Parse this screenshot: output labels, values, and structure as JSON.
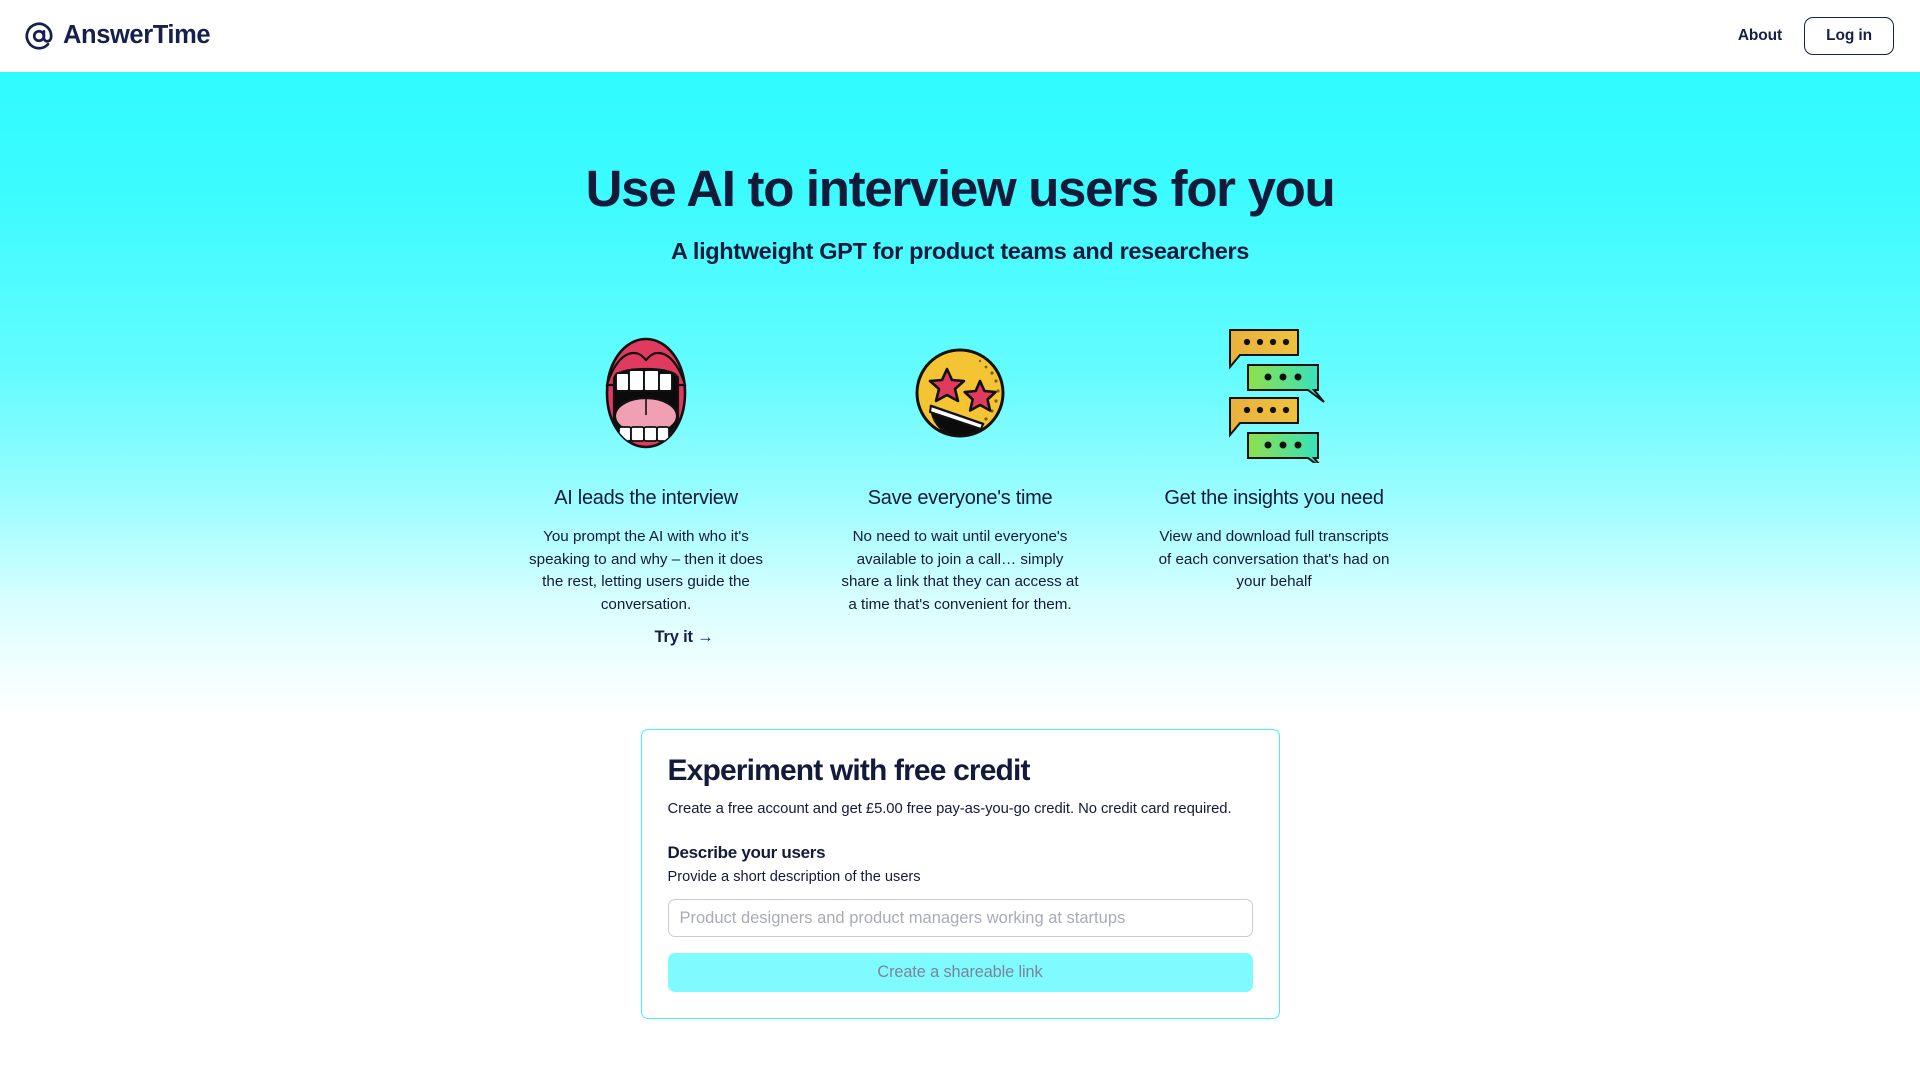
{
  "header": {
    "brand_name": "AnswerTime",
    "brand_icon": "at-circle-logo-icon",
    "about_label": "About",
    "login_label": "Log in"
  },
  "hero": {
    "headline": "Use AI to interview users for you",
    "subhead": "A lightweight GPT for product teams and researchers",
    "try_it_label": "Try it →"
  },
  "features": [
    {
      "icon": "open-mouth-emoji-icon",
      "title": "AI leads the interview",
      "body": "You prompt the AI with who it's speaking to and why – then it does the rest, letting users guide the conversation."
    },
    {
      "icon": "star-struck-emoji-icon",
      "title": "Save everyone's time",
      "body": "No need to wait until everyone's available to join a call… simply share a link that they can access at a time that's convenient for them."
    },
    {
      "icon": "speech-bubbles-icon",
      "title": "Get the insights you need",
      "body": "View and download full transcripts of each conversation that's had on your behalf"
    }
  ],
  "signup_card": {
    "title": "Experiment with free credit",
    "subtitle": "Create a free account and get £5.00 free pay-as-you-go credit. No credit card required.",
    "field_label": "Describe your users",
    "field_hint": "Provide a short description of the users",
    "input_value": "",
    "input_placeholder": "Product designers and product managers working at startups",
    "cta_label": "Create a shareable link"
  },
  "colors": {
    "cyan": "#2ffbff",
    "navy": "#131a3a",
    "card_border": "#4beff0",
    "cta_bg": "#7ffbff",
    "cta_text": "#7b8597"
  }
}
